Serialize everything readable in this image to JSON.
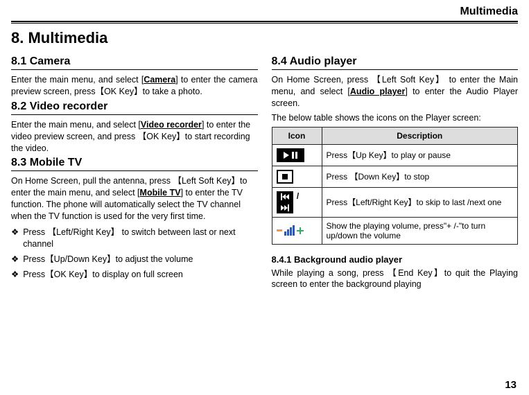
{
  "header": "Multimedia",
  "chapter": "8.  Multimedia",
  "page_number": "13",
  "left": {
    "s1": {
      "title": "8.1 Camera",
      "p1a": "Enter the main menu, and select [",
      "p1b": "Camera",
      "p1c": "] to enter the camera preview screen, press【OK Key】to take a photo."
    },
    "s2": {
      "title": "8.2 Video recorder",
      "p1a": "Enter the main menu, and select [",
      "p1b": "Video recorder",
      "p1c": "] to enter the video preview screen, and press  【OK Key】to start recording the video."
    },
    "s3": {
      "title": "8.3 Mobile TV",
      "p1a": "On Home Screen, pull the antenna, press   【Left Soft Key】to enter the main menu, and select [",
      "p1b": "Mobile TV",
      "p1c": "] to enter the TV function. The phone will automatically select the TV channel when the TV function is used for the very first time.",
      "b1": "Press 【Left/Right Key】 to switch between last or next channel",
      "b2": "Press【Up/Down Key】to adjust the volume",
      "b3": "Press【OK Key】to display on full screen"
    }
  },
  "right": {
    "s4": {
      "title": "8.4 Audio player",
      "p1a": "On Home Screen, press 【Left Soft Key】 to enter the Main menu, and select [",
      "p1b": "Audio player",
      "p1c": "] to enter the Audio Player screen.",
      "p2": "The below table shows the icons on the Player screen:",
      "table": {
        "h1": "Icon",
        "h2": "Description",
        "r1": "Press【Up Key】to play or pause",
        "r2": "Press 【Down Key】to stop",
        "r3": "Press【Left/Right Key】to skip to last /next one",
        "r4": "Show the playing volume, press\"+ /-\"to turn up/down the volume"
      },
      "sub_title": "8.4.1 Background audio player",
      "sub_p1": "While playing a song, press 【End Key】to quit the Playing screen to enter the background playing"
    }
  }
}
